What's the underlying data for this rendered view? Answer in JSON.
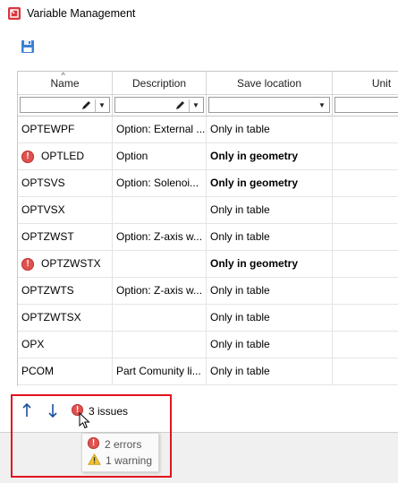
{
  "window": {
    "title": "Variable Management"
  },
  "toolbar": {
    "save_icon": "floppy-disk-icon"
  },
  "grid": {
    "columns": [
      {
        "label": "Name",
        "sorted": true,
        "filter": true
      },
      {
        "label": "Description",
        "filter": true
      },
      {
        "label": "Save location",
        "filter": true
      },
      {
        "label": "Unit",
        "filter": true
      }
    ],
    "rows": [
      {
        "name": "OPTEWPF",
        "description": "Option: External ...",
        "save_location": "Only in table",
        "bold": false,
        "error": false
      },
      {
        "name": "OPTLED",
        "description": "Option",
        "save_location": "Only in geometry",
        "bold": true,
        "error": true
      },
      {
        "name": "OPTSVS",
        "description": "Option: Solenoi...",
        "save_location": "Only in geometry",
        "bold": true,
        "error": false
      },
      {
        "name": "OPTVSX",
        "description": "",
        "save_location": "Only in table",
        "bold": false,
        "error": false
      },
      {
        "name": "OPTZWST",
        "description": "Option: Z-axis w...",
        "save_location": "Only in table",
        "bold": false,
        "error": false
      },
      {
        "name": "OPTZWSTX",
        "description": "",
        "save_location": "Only in geometry",
        "bold": true,
        "error": true
      },
      {
        "name": "OPTZWTS",
        "description": "Option: Z-axis w...",
        "save_location": "Only in table",
        "bold": false,
        "error": false
      },
      {
        "name": "OPTZWTSX",
        "description": "",
        "save_location": "Only in table",
        "bold": false,
        "error": false
      },
      {
        "name": "OPX",
        "description": "",
        "save_location": "Only in table",
        "bold": false,
        "error": false
      },
      {
        "name": "PCOM",
        "description": "Part Comunity li...",
        "save_location": "Only in table",
        "bold": false,
        "error": false
      }
    ]
  },
  "footer": {
    "move_up_icon": "arrow-up-icon",
    "move_down_icon": "arrow-down-icon",
    "issues_label": "3 issues",
    "tooltip": {
      "errors": "2 errors",
      "warnings": "1 warning"
    }
  },
  "colors": {
    "error": "#e0524f",
    "warning": "#f2c230",
    "highlight": "#e0141e",
    "arrow": "#1b4f9c"
  }
}
